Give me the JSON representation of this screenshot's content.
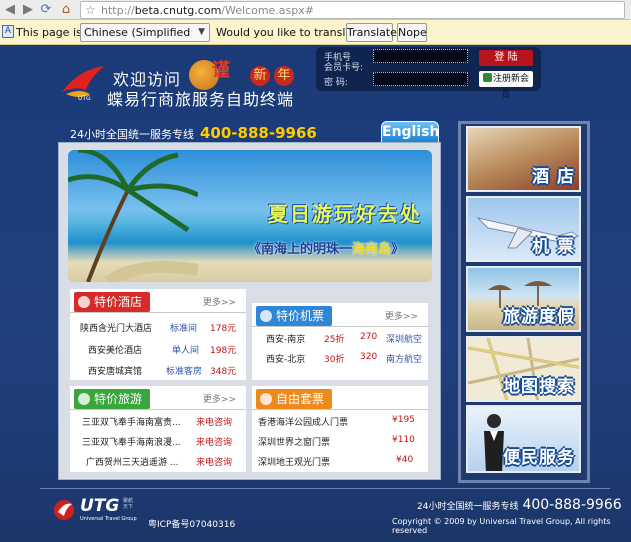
{
  "browser": {
    "url_prefix": "http://",
    "url_host": "beta.cnutg.com",
    "url_path": "/Welcome.aspx#"
  },
  "translate_bar": {
    "text1": "This page is in",
    "language": "Chinese (Simplified Han)",
    "text2": "Would you like to translate it?",
    "translate_button": "Translate",
    "nope_button": "Nope"
  },
  "header": {
    "welcome": "欢迎访问",
    "tagline": "蝶易行商旅服务自助终端",
    "new_year_prefix": "谨",
    "new_year": [
      "新",
      "年"
    ],
    "logo_small": "UTG",
    "logo_caption": "易行商旅"
  },
  "login": {
    "phone_label": "手机号",
    "card_label": "会员卡号:",
    "password_label": "密    码:",
    "login_button": "登 陆",
    "register_button": "注册新会员"
  },
  "hotline": {
    "label": "24小时全国统一服务专线",
    "number": "400-888-9966"
  },
  "english_tab": "English",
  "banner": {
    "title": "夏日游玩好去处",
    "subtitle_prefix": "《南海上的明珠一",
    "subtitle_highlight": "海南岛",
    "subtitle_suffix": "》"
  },
  "hotels": {
    "title": "特价酒店",
    "more": "更多>>",
    "rows": [
      {
        "name": "陕西含光门大酒店",
        "type": "标准间",
        "price": "178元"
      },
      {
        "name": "西安美伦酒店",
        "type": "单人间",
        "price": "198元"
      },
      {
        "name": "西安唐城宾馆",
        "type": "标准客房",
        "price": "348元"
      }
    ]
  },
  "flights": {
    "title": "特价机票",
    "more": "更多>>",
    "rows": [
      {
        "route": "西安-南京",
        "discount": "25折",
        "price": "270",
        "airline": "深圳航空"
      },
      {
        "route": "西安-北京",
        "discount": "30折",
        "price": "320",
        "airline": "南方航空"
      }
    ]
  },
  "tours": {
    "title": "特价旅游",
    "more": "更多>>",
    "rows": [
      {
        "name": "三亚双飞奉手海南富贵...",
        "price": "来电咨询"
      },
      {
        "name": "三亚双飞奉手海南浪漫...",
        "price": "来电咨询"
      },
      {
        "name": "广西贺州三天逍遥游 ...",
        "price": "来电咨询"
      }
    ]
  },
  "packages": {
    "title": "自由套票",
    "more": "更多>>",
    "rows": [
      {
        "name": "香港海洋公园成人门票",
        "price": "¥195"
      },
      {
        "name": "深圳世界之窗门票",
        "price": "¥110"
      },
      {
        "name": "深圳地王观光门票",
        "price": "¥40"
      }
    ]
  },
  "sidebar": {
    "tiles": [
      "酒 店",
      "机 票",
      "旅游度假",
      "地图搜索",
      "便民服务"
    ]
  },
  "footer": {
    "logo": "UTG",
    "logo_sub": "Universal Travel Group",
    "logo_cn": "聚航天下",
    "icp": "粤ICP备号07040316",
    "hotline_label": "24小时全国统一服务专线",
    "hotline_number": "400-888-9966",
    "copyright": "Copyright © 2009 by Universal Travel Group, All rights reserved"
  },
  "colors": {
    "site_bg": "#1d3d78",
    "hotel_tag": "#d72a2a",
    "flight_tag": "#2d86d6",
    "tour_tag": "#3aa63e",
    "package_tag": "#ee8a1c",
    "price_red": "#c21515",
    "hotline_yellow": "#ffcc00"
  }
}
